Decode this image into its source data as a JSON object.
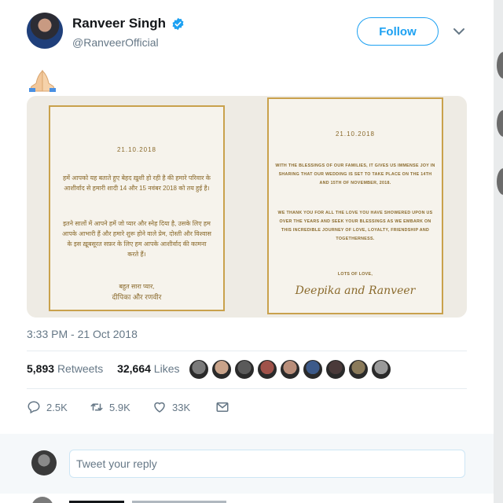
{
  "author": {
    "name": "Ranveer Singh",
    "handle": "@RanveerOfficial",
    "verified_icon": "verified-badge-icon",
    "follow_label": "Follow",
    "menu_icon": "chevron-down-icon"
  },
  "tweet": {
    "emoji_icon": "folded-hands-emoji",
    "timestamp": "3:33 PM - 21 Oct 2018"
  },
  "invitation": {
    "left_card": {
      "date": "21.10.2018",
      "para1": "हमें आपको यह बताते हुए बेहद ख़ुशी हो रही है की हमारे परिवार के आशीर्वाद से हमारी शादी 14 और 15 नवंबर 2018 को तय हुई है।",
      "para2": "इतने सालों में आपने हमें जो प्यार और स्नेह दिया है, उसके लिए हम आपके आभारी हैं और हमारे शुरू होने वाले प्रेम, दोस्ती और विश्वास के इस ख़ूबसूरत सफ़र के लिए हम आपके आशीर्वाद की कामना करते हैं।",
      "closing": "बहुत सारा प्यार,",
      "names": "दीपिका और रणवीर"
    },
    "right_card": {
      "date": "21.10.2018",
      "para1": "WITH THE BLESSINGS OF OUR FAMILIES, IT GIVES US IMMENSE JOY IN SHARING THAT OUR WEDDING IS SET TO TAKE PLACE ON THE 14TH AND 15TH OF NOVEMBER, 2018.",
      "para2": "WE THANK YOU FOR ALL THE LOVE YOU HAVE SHOWERED UPON US OVER THE YEARS AND SEEK YOUR BLESSINGS AS WE EMBARK ON THIS INCREDIBLE JOURNEY OF LOVE, LOYALTY, FRIENDSHIP AND TOGETHERNESS.",
      "closing": "LOTS OF LOVE,",
      "signature": "Deepika and Ranveer"
    }
  },
  "stats": {
    "retweets_count": "5,893",
    "retweets_label": "Retweets",
    "likes_count": "32,664",
    "likes_label": "Likes",
    "liker_avatar_colors": [
      "#7a7a7a",
      "#c9a38a",
      "#5a5a5a",
      "#a0524a",
      "#b98e7a",
      "#3c5a8a",
      "#4a3a3a",
      "#8a7a5a",
      "#9a9a9a"
    ]
  },
  "actions": {
    "replies": "2.5K",
    "retweets": "5.9K",
    "likes": "33K",
    "reply_icon": "reply-icon",
    "retweet_icon": "retweet-icon",
    "like_icon": "heart-icon",
    "dm_icon": "envelope-icon"
  },
  "reply": {
    "placeholder": "Tweet your reply"
  },
  "colors": {
    "accent": "#1da1f2",
    "gold": "#c9a14c",
    "muted": "#657786"
  }
}
